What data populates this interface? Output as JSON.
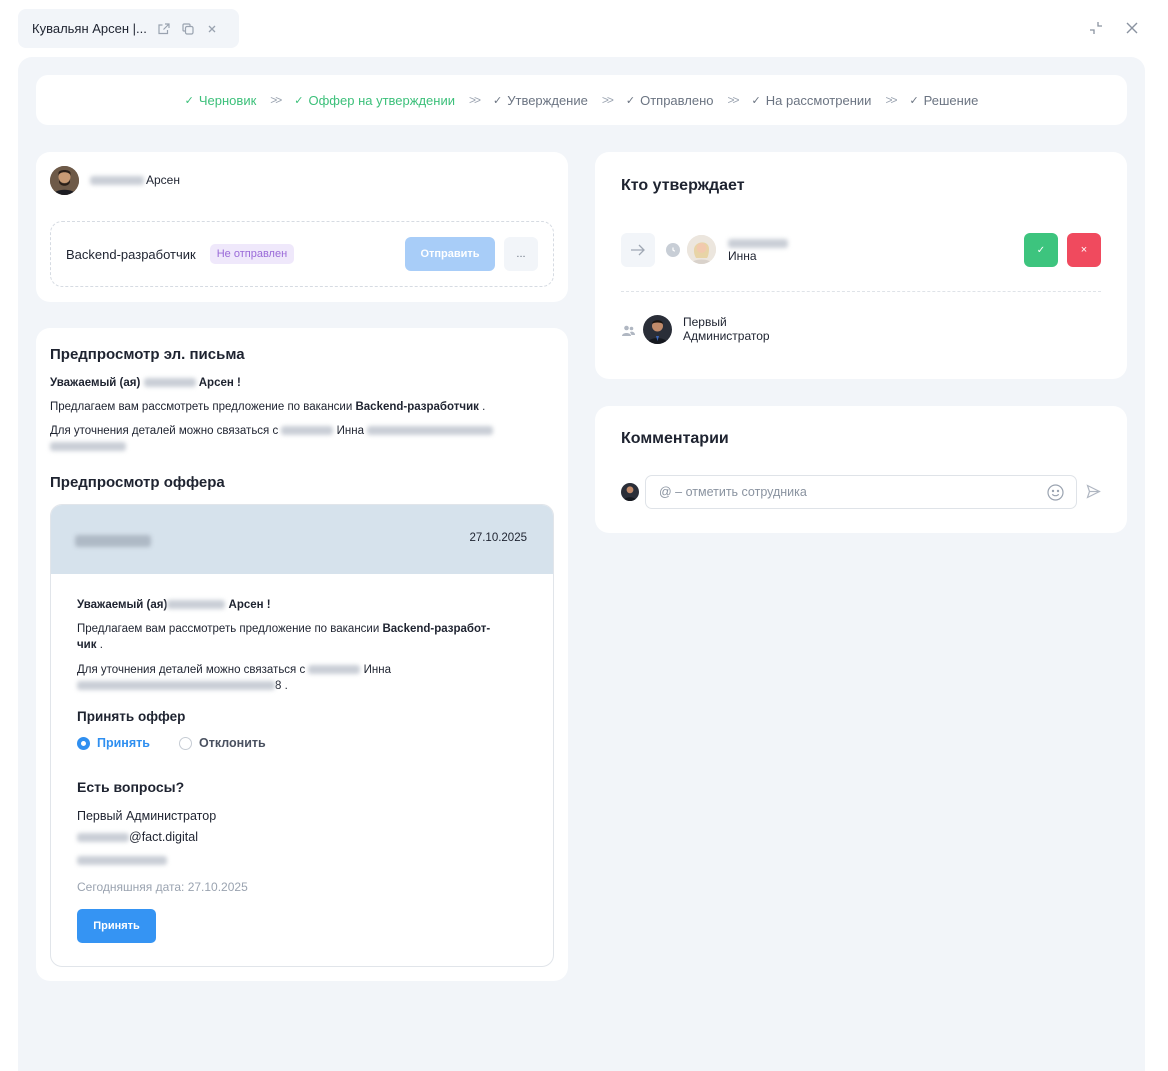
{
  "tab": {
    "title": "Кувальян Арсен |..."
  },
  "stepper": [
    {
      "label": "Черновик",
      "state": "done"
    },
    {
      "label": "Оффер на утверждении",
      "state": "done"
    },
    {
      "label": "Утверждение",
      "state": "pending"
    },
    {
      "label": "Отправлено",
      "state": "pending"
    },
    {
      "label": "На рассмотрении",
      "state": "pending"
    },
    {
      "label": "Решение",
      "state": "pending"
    }
  ],
  "candidate": {
    "name": "Арсен",
    "vacancy": "Backend-разработчик",
    "status_badge": "Не отправлен",
    "send_label": "Отправить",
    "more_label": "..."
  },
  "email_preview": {
    "title": "Предпросмотр эл. письма",
    "greeting_prefix": "Уважаемый (ая)",
    "greeting_name": "Арсен !",
    "line1_prefix": "Предлагаем вам рассмотреть предложение по вакансии",
    "line1_vacancy": "Backend-разработчик",
    "line1_suffix": ".",
    "line2_prefix": "Для уточнения деталей можно связаться с",
    "line2_name": "Инна"
  },
  "offer_preview": {
    "title": "Предпросмотр оффера",
    "date": "27.10.2025",
    "greeting_prefix": "Уважаемый (ая)",
    "greeting_name": "Арсен !",
    "line1_prefix": "Предлагаем вам рассмотреть предложение по вакансии",
    "line1_vacancy_a": "Backend-разработ-",
    "line1_vacancy_b": "чик",
    "line1_suffix": ".",
    "line2_prefix": "Для уточнения деталей можно связаться с",
    "line2_name": "Инна",
    "line2_tail": "8 .",
    "accept_title": "Принять оффер",
    "option_accept": "Принять",
    "option_decline": "Отклонить",
    "questions_title": "Есть вопросы?",
    "contact_name": "Первый Администратор",
    "contact_email_domain": "@fact.digital",
    "today_label": "Сегодняшняя дата: 27.10.2025",
    "accept_button": "Принять"
  },
  "approvers": {
    "title": "Кто утверждает",
    "approver_name": "Инна",
    "approve_symbol": "✓",
    "reject_symbol": "×",
    "initiator_first": "Первый",
    "initiator_last": "Администратор"
  },
  "comments": {
    "title": "Комментарии",
    "placeholder": "@ – отметить сотрудника"
  },
  "colors": {
    "accent": "#3594f3",
    "done": "#3cc07a",
    "approve": "#3dc47e",
    "reject": "#f04a5e",
    "badge_text": "#9a6ad8",
    "badge_bg": "#efe8fb"
  }
}
